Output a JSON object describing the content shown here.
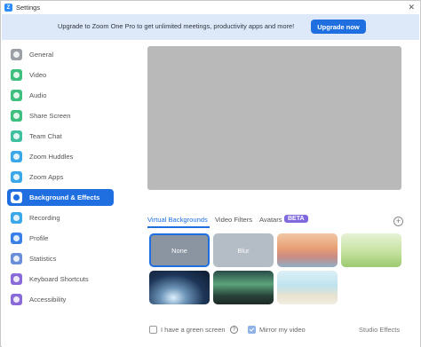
{
  "window": {
    "title": "Settings",
    "logo_letter": "Z",
    "close_glyph": "✕"
  },
  "banner": {
    "text": "Upgrade to Zoom One Pro to get unlimited meetings, productivity apps and more!",
    "button_label": "Upgrade now"
  },
  "sidebar": {
    "items": [
      {
        "label": "General",
        "icon": "gear-icon",
        "color": "#9aa0a6"
      },
      {
        "label": "Video",
        "icon": "video-icon",
        "color": "#3fbf7f"
      },
      {
        "label": "Audio",
        "icon": "headphones-icon",
        "color": "#3fbf7f"
      },
      {
        "label": "Share Screen",
        "icon": "share-screen-icon",
        "color": "#3fbf7f"
      },
      {
        "label": "Team Chat",
        "icon": "chat-icon",
        "color": "#3fbfa0"
      },
      {
        "label": "Zoom Huddles",
        "icon": "huddles-icon",
        "color": "#3aa8e8"
      },
      {
        "label": "Zoom Apps",
        "icon": "apps-icon",
        "color": "#3aa8e8"
      },
      {
        "label": "Background & Effects",
        "icon": "background-icon",
        "color": "#1f6fe0",
        "active": true
      },
      {
        "label": "Recording",
        "icon": "recording-icon",
        "color": "#3aa8e8"
      },
      {
        "label": "Profile",
        "icon": "profile-icon",
        "color": "#3a7fe8"
      },
      {
        "label": "Statistics",
        "icon": "statistics-icon",
        "color": "#6a8fd8"
      },
      {
        "label": "Keyboard Shortcuts",
        "icon": "keyboard-icon",
        "color": "#8a6ad8"
      },
      {
        "label": "Accessibility",
        "icon": "accessibility-icon",
        "color": "#8a6ad8"
      }
    ]
  },
  "main": {
    "tabs": [
      {
        "label": "Virtual Backgrounds",
        "active": true
      },
      {
        "label": "Video Filters"
      },
      {
        "label": "Avatars"
      }
    ],
    "beta_label": "BETA",
    "add_glyph": "+",
    "tiles": [
      {
        "label": "None",
        "kind": "none",
        "selected": true
      },
      {
        "label": "Blur",
        "kind": "blur"
      },
      {
        "label": "",
        "kind": "bridge"
      },
      {
        "label": "",
        "kind": "grass"
      },
      {
        "label": "",
        "kind": "earth"
      },
      {
        "label": "",
        "kind": "aurora"
      },
      {
        "label": "",
        "kind": "beach"
      }
    ],
    "green_screen_label": "I have a green screen",
    "green_screen_checked": false,
    "help_glyph": "?",
    "mirror_label": "Mirror my video",
    "mirror_checked": true,
    "studio_effects_label": "Studio Effects"
  }
}
